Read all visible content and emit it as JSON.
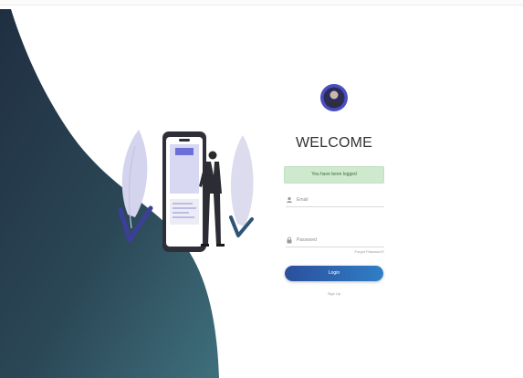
{
  "hero": {
    "icons": [
      "phone-icon",
      "person-icon",
      "leaf-icon",
      "check-icon"
    ]
  },
  "login": {
    "title": "WELCOME",
    "alert_text": "You have been logged",
    "email_label": "Email",
    "email_icon": "user-icon",
    "password_label": "Password",
    "password_icon": "lock-icon",
    "forgot_label": "Forgot Password?",
    "button_label": "Login",
    "signup_label": "Sign Up",
    "avatar_icon": "avatar-icon"
  },
  "colors": {
    "wave_dark": "#263a4b",
    "wave_light": "#3b6a79",
    "button_start": "#2b4f9c",
    "button_end": "#2f7fc7",
    "alert_bg": "#cfe9cf",
    "avatar_ring": "#4a4ec0"
  }
}
